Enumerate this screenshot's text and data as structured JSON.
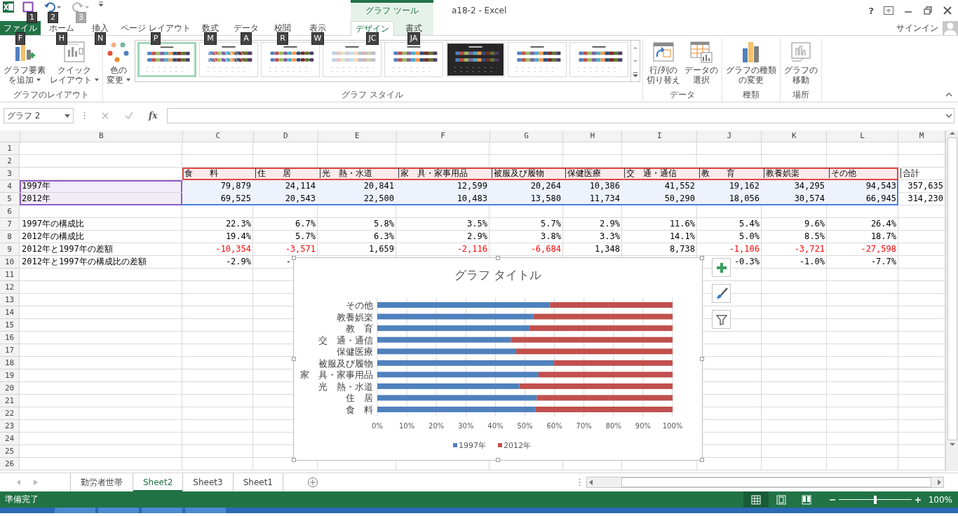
{
  "window": {
    "title": "a18-2 - Excel",
    "help": "?",
    "account": "サインイン"
  },
  "quick_access": [
    {
      "kind": "save",
      "keytip": "1",
      "disabled": false
    },
    {
      "kind": "undo",
      "keytip": "2",
      "disabled": false
    },
    {
      "kind": "redo",
      "keytip": "3",
      "disabled": true
    }
  ],
  "context_group": "グラフ ツール",
  "tabs": [
    {
      "label": "ファイル",
      "keytip": "F",
      "kind": "file",
      "selected": false
    },
    {
      "label": "ホーム",
      "keytip": "H",
      "kind": "normal",
      "selected": false
    },
    {
      "label": "挿入",
      "keytip": "N",
      "kind": "normal",
      "selected": false
    },
    {
      "label": "ページ レイアウト",
      "keytip": "P",
      "kind": "normal",
      "selected": false
    },
    {
      "label": "数式",
      "keytip": "M",
      "kind": "normal",
      "selected": false
    },
    {
      "label": "データ",
      "keytip": "A",
      "kind": "normal",
      "selected": false
    },
    {
      "label": "校閲",
      "keytip": "R",
      "kind": "normal",
      "selected": false
    },
    {
      "label": "表示",
      "keytip": "W",
      "kind": "normal",
      "selected": false
    },
    {
      "label": "デザイン",
      "keytip": "JC",
      "kind": "context",
      "selected": true
    },
    {
      "label": "書式",
      "keytip": "JA",
      "kind": "context",
      "selected": false
    }
  ],
  "ribbon": [
    {
      "label": "グラフのレイアウト",
      "buttons": [
        {
          "lines": [
            "グラフ要素",
            "を追加"
          ],
          "kind": "add_element",
          "dropdown": true
        },
        {
          "lines": [
            "クイック",
            "レイアウト"
          ],
          "kind": "quick_layout",
          "dropdown": true
        }
      ]
    },
    {
      "label": "グラフ スタイル",
      "buttons": [
        {
          "lines": [
            "色の",
            "変更"
          ],
          "kind": "colors",
          "dropdown": true
        }
      ],
      "styles": [
        {
          "kind": "plain",
          "selected": true
        },
        {
          "kind": "hatched",
          "selected": false
        },
        {
          "kind": "rounded",
          "selected": false
        },
        {
          "kind": "pale",
          "selected": false
        },
        {
          "kind": "plain",
          "selected": false
        },
        {
          "kind": "dark",
          "selected": false
        },
        {
          "kind": "plain",
          "selected": false
        },
        {
          "kind": "plain",
          "selected": false
        }
      ]
    },
    {
      "label": "データ",
      "buttons": [
        {
          "lines": [
            "行/列の",
            "切り替え"
          ],
          "kind": "switch",
          "dropdown": false
        },
        {
          "lines": [
            "データの",
            "選択"
          ],
          "kind": "select_data",
          "dropdown": false
        }
      ]
    },
    {
      "label": "種類",
      "buttons": [
        {
          "lines": [
            "グラフの種類",
            "の変更"
          ],
          "kind": "chart_type",
          "dropdown": false
        }
      ]
    },
    {
      "label": "場所",
      "buttons": [
        {
          "lines": [
            "グラフの",
            "移動"
          ],
          "kind": "move_chart",
          "dropdown": false
        }
      ]
    }
  ],
  "formula_bar": {
    "name_box": "グラフ 2",
    "function_label": "fx"
  },
  "sheet": {
    "columns": [
      "B",
      "C",
      "D",
      "E",
      "F",
      "G",
      "H",
      "I",
      "J",
      "K",
      "L",
      "M"
    ],
    "rows": [
      {
        "num": "1",
        "cells": []
      },
      {
        "num": "2",
        "cells": []
      },
      {
        "num": "3",
        "kind": "names",
        "cells": [
          null,
          "食　　料",
          "住　　居",
          "光　熱・水道",
          "家　具・家事用品",
          "被服及び履物",
          "保健医療",
          "交　通・通信",
          "教　　育",
          "教養娯楽",
          "その他",
          "合計"
        ]
      },
      {
        "num": "4",
        "kind": "values",
        "cells": [
          "1997年",
          "79,879",
          "24,114",
          "20,841",
          "12,599",
          "20,264",
          "10,386",
          "41,552",
          "19,162",
          "34,295",
          "94,543",
          "357,635"
        ]
      },
      {
        "num": "5",
        "kind": "values",
        "cells": [
          "2012年",
          "69,525",
          "20,543",
          "22,500",
          "10,483",
          "13,580",
          "11,734",
          "50,290",
          "18,056",
          "30,574",
          "66,945",
          "314,230"
        ]
      },
      {
        "num": "6",
        "cells": []
      },
      {
        "num": "7",
        "cells": [
          "1997年の構成比",
          "22.3%",
          "6.7%",
          "5.8%",
          "3.5%",
          "5.7%",
          "2.9%",
          "11.6%",
          "5.4%",
          "9.6%",
          "26.4%",
          null
        ]
      },
      {
        "num": "8",
        "cells": [
          "2012年の構成比",
          "19.4%",
          "5.7%",
          "6.3%",
          "2.9%",
          "3.8%",
          "3.3%",
          "14.1%",
          "5.0%",
          "8.5%",
          "18.7%",
          null
        ]
      },
      {
        "num": "9",
        "cells": [
          "2012年と1997年の差額",
          {
            "text": "-10,354",
            "negative": true
          },
          {
            "text": "-3,571",
            "negative": true
          },
          "1,659",
          {
            "text": "-2,116",
            "negative": true
          },
          {
            "text": "-6,684",
            "negative": true
          },
          "1,348",
          "8,738",
          {
            "text": "-1,106",
            "negative": true
          },
          {
            "text": "-3,721",
            "negative": true
          },
          {
            "text": "-27,598",
            "negative": true
          },
          null
        ]
      },
      {
        "num": "10",
        "cells": [
          "2012年と1997年の構成比の差額",
          "-2.9%",
          {
            "text": "-",
            "clipped": true
          },
          null,
          null,
          null,
          null,
          null,
          "-0.3%",
          "-1.0%",
          "-7.7%",
          null
        ]
      },
      {
        "num": "11",
        "cells": []
      },
      {
        "num": "12",
        "cells": []
      },
      {
        "num": "13",
        "cells": []
      },
      {
        "num": "14",
        "cells": []
      },
      {
        "num": "15",
        "cells": []
      },
      {
        "num": "16",
        "cells": []
      },
      {
        "num": "17",
        "cells": []
      },
      {
        "num": "18",
        "cells": []
      },
      {
        "num": "19",
        "cells": []
      },
      {
        "num": "20",
        "cells": []
      },
      {
        "num": "21",
        "cells": []
      },
      {
        "num": "22",
        "cells": []
      },
      {
        "num": "23",
        "cells": []
      },
      {
        "num": "24",
        "cells": []
      },
      {
        "num": "25",
        "cells": []
      },
      {
        "num": "26",
        "cells": []
      }
    ]
  },
  "chart": {
    "chart_data": {
      "type": "bar",
      "orientation": "horizontal",
      "stacked": true,
      "title": "グラフ タイトル",
      "categories": [
        "その他",
        "教養娯楽",
        "教　育",
        "交　通・通信",
        "保健医療",
        "被服及び履物",
        "家　具・家事用品",
        "光　熱・水道",
        "住　居",
        "食　料"
      ],
      "series": [
        {
          "name": "1997年",
          "color": "#4f81bd",
          "values": [
            58.5,
            52.9,
            51.5,
            45.2,
            47.0,
            59.9,
            54.6,
            48.1,
            54.0,
            53.5
          ]
        },
        {
          "name": "2012年",
          "color": "#c0504d",
          "values": [
            41.5,
            47.1,
            48.5,
            54.8,
            53.0,
            40.1,
            45.4,
            51.9,
            46.0,
            46.5
          ]
        }
      ],
      "grid": true,
      "legend": true,
      "xlim": [
        0,
        100
      ],
      "xticks": [
        {
          "value": 0,
          "label": "0%"
        },
        {
          "value": 10,
          "label": "10%"
        },
        {
          "value": 20,
          "label": "20%"
        },
        {
          "value": 30,
          "label": "30%"
        },
        {
          "value": 40,
          "label": "40%"
        },
        {
          "value": 50,
          "label": "50%"
        },
        {
          "value": 60,
          "label": "60%"
        },
        {
          "value": 70,
          "label": "70%"
        },
        {
          "value": 80,
          "label": "80%"
        },
        {
          "value": 90,
          "label": "90%"
        },
        {
          "value": 100,
          "label": "100%"
        }
      ]
    },
    "side_buttons": [
      {
        "kind": "elements"
      },
      {
        "kind": "styles"
      },
      {
        "kind": "filter"
      }
    ]
  },
  "sheet_tabs": [
    {
      "label": "勤労者世帯",
      "selected": false
    },
    {
      "label": "Sheet2",
      "selected": true
    },
    {
      "label": "Sheet3",
      "selected": false
    },
    {
      "label": "Sheet1",
      "selected": false
    }
  ],
  "status_bar": {
    "text": "準備完了",
    "views": [
      {
        "kind": "normal",
        "selected": true
      },
      {
        "kind": "page_layout",
        "selected": false
      },
      {
        "kind": "page_break",
        "selected": false
      }
    ],
    "zoom": {
      "level": 0.5,
      "reading": "100%"
    }
  }
}
